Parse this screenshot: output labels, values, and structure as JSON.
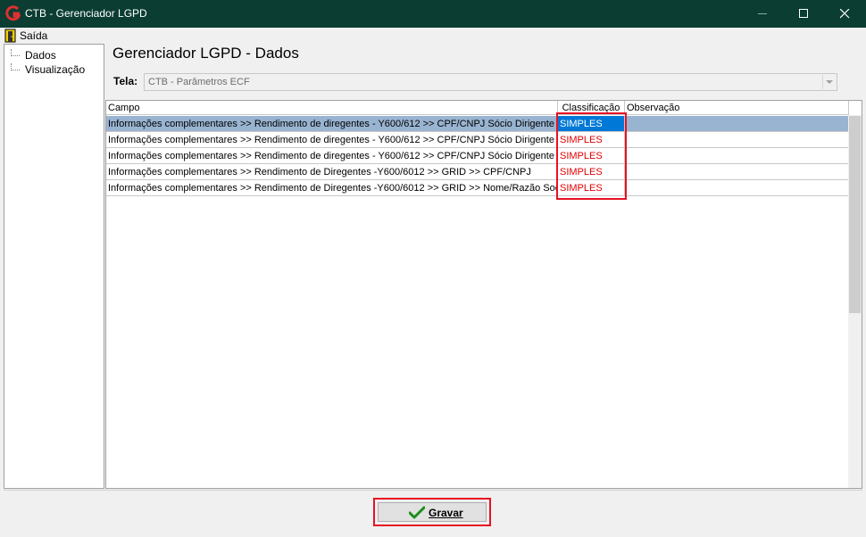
{
  "window": {
    "title": "CTB - Gerenciador LGPD"
  },
  "menu": {
    "exit_label": "Saída"
  },
  "tree": {
    "items": [
      {
        "label": "Dados"
      },
      {
        "label": "Visualização"
      }
    ]
  },
  "main": {
    "title": "Gerenciador LGPD - Dados",
    "tela_label": "Tela:",
    "tela_value": "CTB - Parâmetros ECF"
  },
  "grid": {
    "columns": [
      "Campo",
      "Classificação",
      "Observação"
    ],
    "rows": [
      {
        "campo": "Informações complementares >> Rendimento de diregentes - Y600/612 >> CPF/CNPJ Sócio Dirigente",
        "classificacao": "SIMPLES",
        "observacao": ""
      },
      {
        "campo": "Informações complementares >> Rendimento de diregentes - Y600/612 >> CPF/CNPJ Sócio Dirigente >...",
        "classificacao": "SIMPLES",
        "observacao": ""
      },
      {
        "campo": "Informações complementares >> Rendimento de diregentes - Y600/612 >> CPF/CNPJ Sócio Dirigente >...",
        "classificacao": "SIMPLES",
        "observacao": ""
      },
      {
        "campo": "Informações complementares >> Rendimento de Diregentes -Y600/6012 >> GRID >> CPF/CNPJ",
        "classificacao": "SIMPLES",
        "observacao": ""
      },
      {
        "campo": "Informações complementares >> Rendimento de Diregentes -Y600/6012 >> GRID >> Nome/Razão Social",
        "classificacao": "SIMPLES",
        "observacao": ""
      }
    ]
  },
  "footer": {
    "save_label": "Gravar"
  },
  "colors": {
    "titlebar": "#0b3d33",
    "selection": "#99b4d1",
    "selected_cell": "#0078d7",
    "classification_text": "#e00000",
    "highlight_border": "#e81123"
  }
}
